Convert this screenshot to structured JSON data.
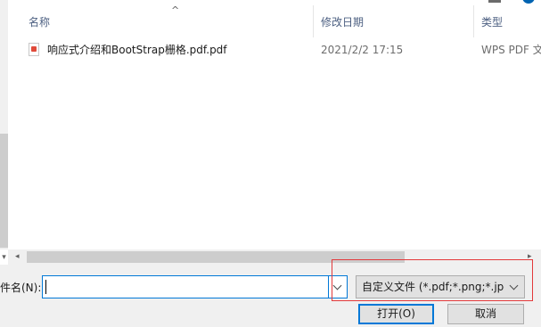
{
  "columns": {
    "name": "名称",
    "date_modified": "修改日期",
    "type": "类型"
  },
  "files": [
    {
      "name": "响应式介绍和BootStrap栅格.pdf.pdf",
      "date_modified": "2021/2/2 17:15",
      "type": "WPS PDF 文"
    }
  ],
  "file_name_field": {
    "label": "件名(N):",
    "value": ""
  },
  "file_type_select": {
    "selected": "自定义文件 (*.pdf;*.png;*.jpeg)"
  },
  "buttons": {
    "open": "打开(O)",
    "cancel": "取消"
  },
  "colors": {
    "accent": "#0078d7",
    "highlight_box": "#e3393b",
    "header_text": "#4d6082"
  },
  "icons": {
    "sort_indicator": "sort-ascending-icon",
    "file_icon": "pdf-file-icon"
  }
}
